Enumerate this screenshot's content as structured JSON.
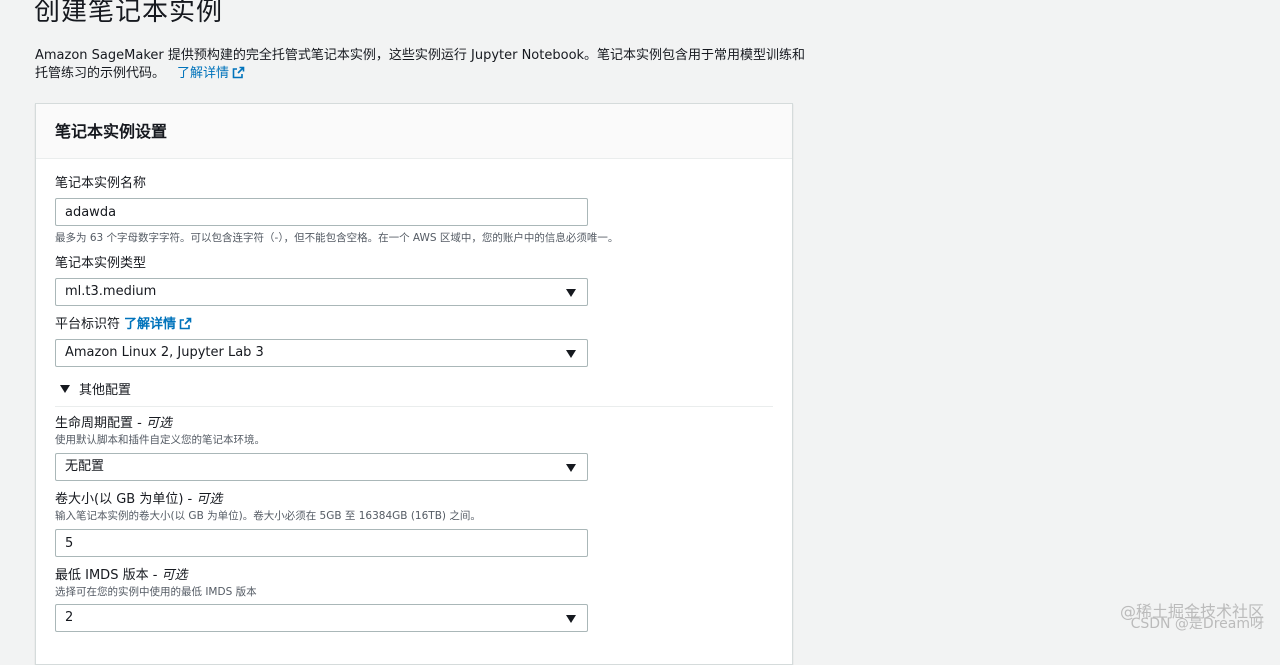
{
  "page": {
    "title": "创建笔记本实例",
    "description": "Amazon SageMaker 提供预构建的完全托管式笔记本实例，这些实例运行 Jupyter Notebook。笔记本实例包含用于常用模型训练和托管练习的示例代码。",
    "learn_more": "了解详情"
  },
  "panel": {
    "title": "笔记本实例设置",
    "name_label": "笔记本实例名称",
    "name_value": "adawda",
    "name_hint": "最多为 63 个字母数字字符。可以包含连字符（-），但不能包含空格。在一个 AWS 区域中，您的账户中的信息必须唯一。",
    "type_label": "笔记本实例类型",
    "type_value": "ml.t3.medium",
    "platform_label": "平台标识符",
    "platform_learn_more": "了解详情",
    "platform_value": "Amazon Linux 2, Jupyter Lab 3",
    "additional_config": "其他配置",
    "lifecycle_label": "生命周期配置 - ",
    "lifecycle_optional": "可选",
    "lifecycle_hint": "使用默认脚本和插件自定义您的笔记本环境。",
    "lifecycle_value": "无配置",
    "volume_label": "卷大小(以 GB 为单位) - ",
    "volume_optional": "可选",
    "volume_hint": "输入笔记本实例的卷大小(以 GB 为单位)。卷大小必须在 5GB 至 16384GB (16TB) 之间。",
    "volume_value": "5",
    "imds_label": "最低 IMDS 版本 - ",
    "imds_optional": "可选",
    "imds_hint": "选择可在您的实例中使用的最低 IMDS 版本",
    "imds_value": "2"
  },
  "watermark": {
    "line1": "@稀土掘金技术社区",
    "line2": "CSDN @是Dream呀"
  }
}
